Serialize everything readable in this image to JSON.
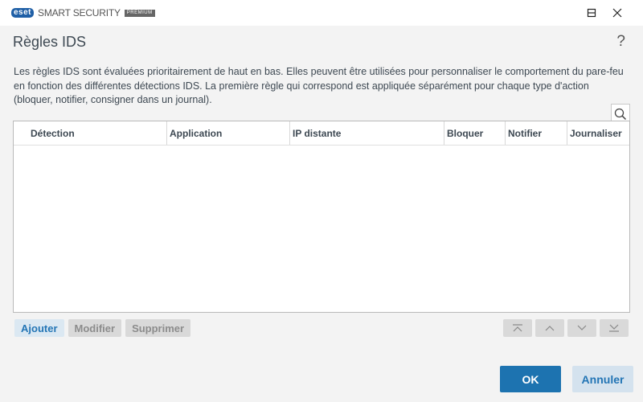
{
  "titlebar": {
    "logo_text": "eset",
    "product_name": "SMART SECURITY",
    "edition_tag": "PREMIUM"
  },
  "dialog": {
    "title": "Règles IDS",
    "help_label": "?",
    "description": "Les règles IDS sont évaluées prioritairement de haut en bas. Elles peuvent être utilisées pour personnaliser le comportement du pare-feu en fonction des différentes détections IDS. La première règle qui correspond est appliquée séparément pour chaque type d'action (bloquer, notifier, consigner dans un journal)."
  },
  "table": {
    "columns": [
      "Détection",
      "Application",
      "IP distante",
      "Bloquer",
      "Notifier",
      "Journaliser"
    ],
    "rows": []
  },
  "actions": {
    "add_label": "Ajouter",
    "edit_label": "Modifier",
    "delete_label": "Supprimer"
  },
  "footer": {
    "ok_label": "OK",
    "cancel_label": "Annuler"
  },
  "icons": {
    "minimize": "minimize-icon",
    "maximize": "maximize-icon",
    "close": "close-icon",
    "search": "search-icon",
    "move_top": "move-top-icon",
    "move_up": "move-up-icon",
    "move_down": "move-down-icon",
    "move_bottom": "move-bottom-icon"
  },
  "colors": {
    "brand": "#1f5fa6",
    "primary_button": "#1d73b0",
    "secondary_button": "#d4e2ee",
    "background": "#f3f3f3"
  }
}
